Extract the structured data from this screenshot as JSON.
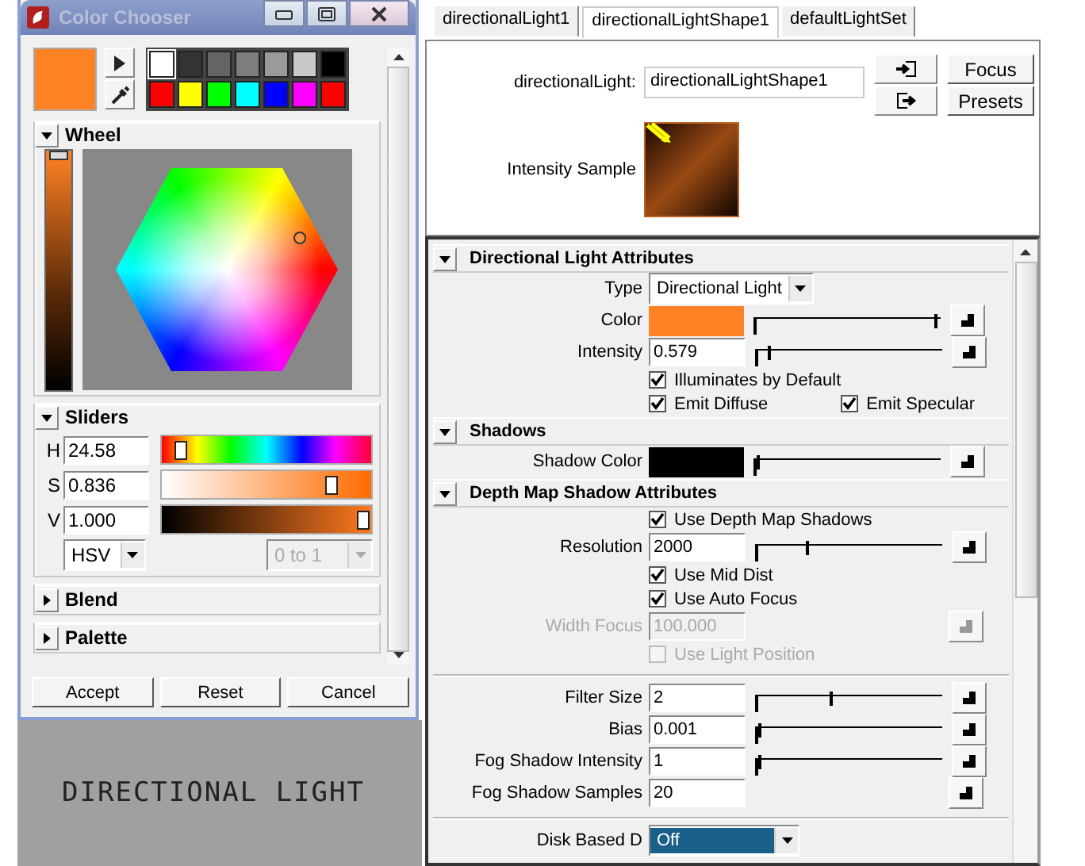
{
  "color_chooser": {
    "title": "Color Chooser",
    "swatches": [
      {
        "color": "#ffffff",
        "selected": true
      },
      {
        "color": "#333333",
        "selected": false
      },
      {
        "color": "#646464",
        "selected": false
      },
      {
        "color": "#7d7d7d",
        "selected": false
      },
      {
        "color": "#9a9a9a",
        "selected": false
      },
      {
        "color": "#c8c8c8",
        "selected": false
      },
      {
        "color": "#000000",
        "selected": false
      },
      {
        "color": "#ff0000",
        "selected": false
      },
      {
        "color": "#ffff00",
        "selected": false
      },
      {
        "color": "#00ff00",
        "selected": false
      },
      {
        "color": "#00ffff",
        "selected": false
      },
      {
        "color": "#0000ff",
        "selected": false
      },
      {
        "color": "#ff00ff",
        "selected": false
      },
      {
        "color": "#ff0000",
        "selected": false
      }
    ],
    "wheel": {
      "label": "Wheel",
      "expanded": true,
      "level": 1
    },
    "sliders": {
      "label": "Sliders",
      "expanded": true,
      "rows": [
        {
          "kind": "hue",
          "label": "H",
          "value": "24.58",
          "level": 0.07
        },
        {
          "kind": "saturation",
          "label": "S",
          "value": "0.836",
          "level": 0.836
        },
        {
          "kind": "value",
          "label": "V",
          "value": "1.000",
          "level": 1
        }
      ],
      "mode": "HSV",
      "range": {
        "value": "0 to 1",
        "disabled": true
      }
    },
    "sections": [
      {
        "label": "Blend",
        "expanded": false
      },
      {
        "label": "Palette",
        "expanded": false
      }
    ],
    "buttons": [
      "Accept",
      "Reset",
      "Cancel"
    ]
  },
  "caption": "DIRECTIONAL LIGHT",
  "attribute_editor": {
    "tabs": [
      {
        "label": "directionalLight1",
        "selected": false
      },
      {
        "label": "directionalLightShape1",
        "selected": true
      },
      {
        "label": "defaultLightSet",
        "selected": false
      }
    ],
    "node_label": "directionalLight:",
    "node_value": "directionalLightShape1",
    "buttons": [
      "Focus",
      "Presets"
    ],
    "sample_label": "Intensity Sample",
    "sections": [
      {
        "title": "Directional Light Attributes",
        "expanded": true,
        "rows": [
          {
            "kind": "dropdown",
            "label": "Type",
            "value": "Directional Light",
            "highlighted": false
          },
          {
            "kind": "color",
            "label": "Color",
            "color": "#ff8224",
            "level": 1
          },
          {
            "kind": "slider",
            "label": "Intensity",
            "value": "0.579",
            "level": 0.05,
            "disabled": false
          },
          {
            "kind": "checkbox",
            "label": "Illuminates by Default",
            "checked": true,
            "disabled": false
          },
          {
            "kind": "checkbox_pair",
            "items": [
              {
                "label": "Emit Diffuse",
                "checked": true
              },
              {
                "label": "Emit Specular",
                "checked": true
              }
            ]
          }
        ]
      },
      {
        "title": "Shadows",
        "expanded": true,
        "rows": [
          {
            "kind": "color",
            "label": "Shadow Color",
            "color": "#000000",
            "level": 0
          }
        ]
      },
      {
        "title": "Depth Map Shadow Attributes",
        "expanded": true,
        "rows": [
          {
            "kind": "checkbox",
            "label": "Use Depth Map Shadows",
            "checked": true,
            "disabled": false
          },
          {
            "kind": "slider",
            "label": "Resolution",
            "value": "2000",
            "level": 0.27,
            "disabled": false
          },
          {
            "kind": "checkbox",
            "label": "Use Mid Dist",
            "checked": true,
            "disabled": false
          },
          {
            "kind": "checkbox",
            "label": "Use Auto Focus",
            "checked": true,
            "disabled": false
          },
          {
            "kind": "slider",
            "label": "Width Focus",
            "value": "100.000",
            "disabled": true
          },
          {
            "kind": "checkbox",
            "label": "Use Light Position",
            "checked": false,
            "disabled": true
          },
          {
            "kind": "separator"
          },
          {
            "kind": "slider",
            "label": "Filter Size",
            "value": "2",
            "level": 0.4,
            "disabled": false
          },
          {
            "kind": "slider",
            "label": "Bias",
            "value": "0.001",
            "level": 0,
            "disabled": false
          },
          {
            "kind": "slider",
            "label": "Fog Shadow Intensity",
            "value": "1",
            "level": 0,
            "disabled": false
          },
          {
            "kind": "slider",
            "label": "Fog Shadow Samples",
            "value": "20",
            "disabled": false
          },
          {
            "kind": "separator"
          },
          {
            "kind": "dropdown",
            "label": "Disk Based D",
            "value": "Off",
            "highlighted": true
          }
        ]
      }
    ]
  }
}
